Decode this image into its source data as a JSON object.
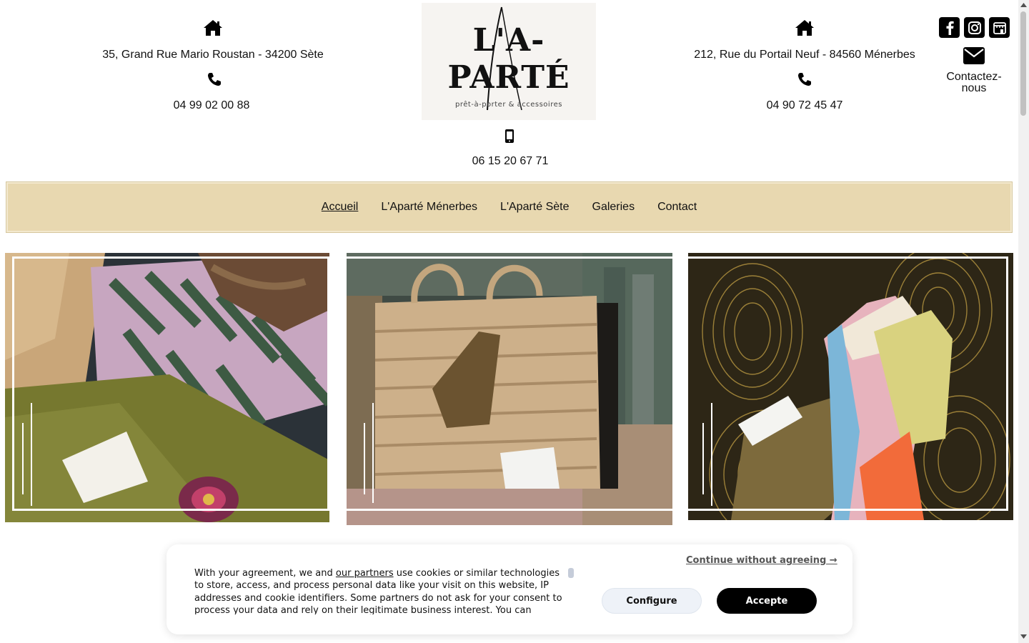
{
  "left_shop": {
    "address": "35, Grand Rue Mario Roustan - 34200 Sète",
    "phone": "04 99 02 00 88"
  },
  "right_shop": {
    "address": "212, Rue du Portail Neuf - 84560 Ménerbes",
    "phone": "04 90 72 45 47"
  },
  "mobile": "06 15 20 67 71",
  "logo": {
    "line1": "L'A-",
    "line2": "PARTÉ",
    "tagline": "prêt-à-porter & accessoires"
  },
  "social": [
    "facebook-icon",
    "instagram-icon",
    "store-icon"
  ],
  "contact": {
    "label": "Contactez-nous"
  },
  "nav": {
    "items": [
      {
        "label": "Accueil",
        "active": true
      },
      {
        "label": "L'Aparté Ménerbes",
        "active": false
      },
      {
        "label": "L'Aparté Sète",
        "active": false
      },
      {
        "label": "Galeries",
        "active": false
      },
      {
        "label": "Contact",
        "active": false
      }
    ]
  },
  "cookie": {
    "text_before": "With your agreement, we and ",
    "partners_link": "our partners",
    "text_after": " use cookies or similar technologies to store, access, and process personal data like your visit on this website, IP addresses and cookie identifiers. Some partners do not ask for your consent to process your data and rely on their legitimate business interest. You can",
    "continue": "Continue without agreeing →",
    "configure": "Configure",
    "accept": "Accepte"
  },
  "colors": {
    "nav_bg": "#e8d8b0",
    "accent": "#000000"
  }
}
